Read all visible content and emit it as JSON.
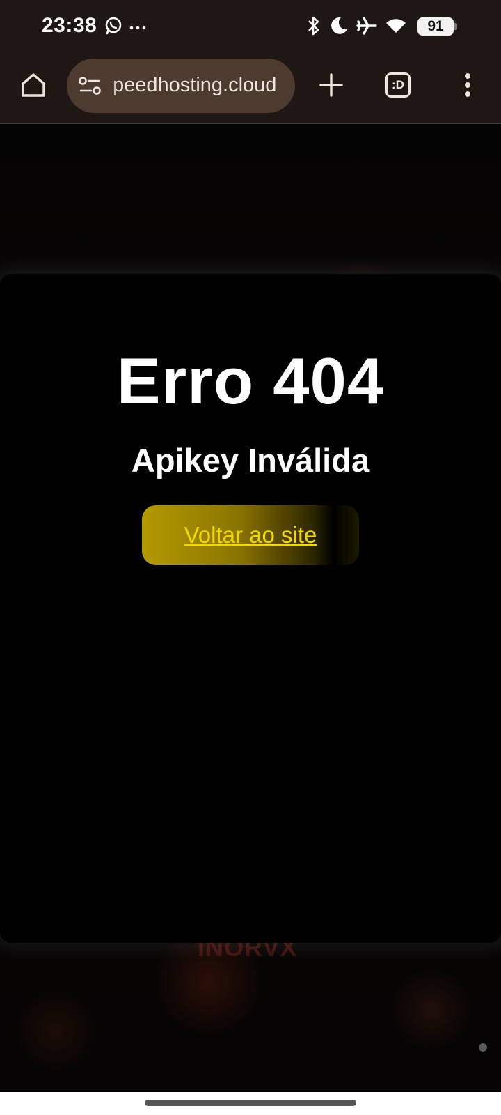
{
  "status_bar": {
    "time": "23:38",
    "left_icons": [
      "whatsapp-icon",
      "more-dots-icon"
    ],
    "right_icons": [
      "bluetooth-icon",
      "do-not-disturb-moon-icon",
      "airplane-mode-icon",
      "wifi-icon"
    ],
    "battery_level": "91"
  },
  "browser": {
    "url_display": "peedhosting.cloud",
    "tab_count_label": ":D",
    "icons": [
      "home-icon",
      "site-info-icon",
      "plus-icon",
      "tabs-icon",
      "kebab-menu-icon"
    ]
  },
  "page": {
    "title": "Erro 404",
    "subtitle": "Apikey Inválida",
    "back_button_label": "Voltar ao site",
    "watermark": "INORVX",
    "colors": {
      "background": "#000000",
      "text": "#ffffff",
      "button_gradient_start": "#b39a00",
      "link_text": "#f0d800",
      "browser_chrome": "#1e1714",
      "url_pill": "#4e3b30"
    }
  }
}
